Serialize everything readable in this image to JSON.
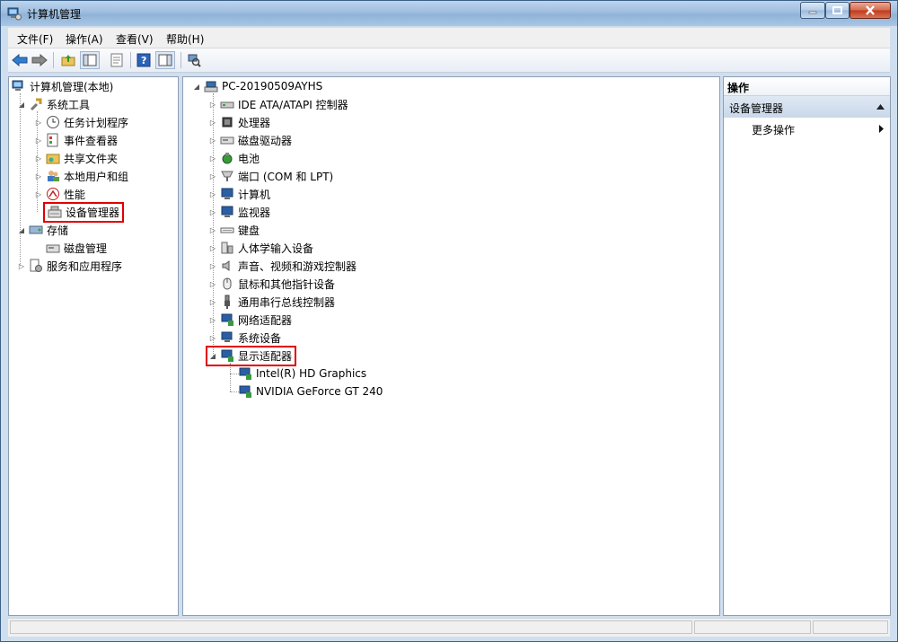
{
  "window": {
    "title": "计算机管理"
  },
  "menubar": {
    "items": [
      "文件(F)",
      "操作(A)",
      "查看(V)",
      "帮助(H)"
    ]
  },
  "left_tree": {
    "root": "计算机管理(本地)",
    "system_tools": "系统工具",
    "system_children": [
      "任务计划程序",
      "事件查看器",
      "共享文件夹",
      "本地用户和组",
      "性能",
      "设备管理器"
    ],
    "storage": "存储",
    "storage_children": [
      "磁盘管理"
    ],
    "services": "服务和应用程序"
  },
  "device_tree": {
    "root": "PC-20190509AYHS",
    "categories": [
      "IDE ATA/ATAPI 控制器",
      "处理器",
      "磁盘驱动器",
      "电池",
      "端口 (COM 和 LPT)",
      "计算机",
      "监视器",
      "键盘",
      "人体学输入设备",
      "声音、视频和游戏控制器",
      "鼠标和其他指针设备",
      "通用串行总线控制器",
      "网络适配器",
      "系统设备",
      "显示适配器"
    ],
    "display_adapters": [
      "Intel(R) HD Graphics",
      "NVIDIA GeForce GT 240"
    ]
  },
  "actions": {
    "header": "操作",
    "section": "设备管理器",
    "more": "更多操作"
  },
  "colors": {
    "highlight": "#e00000",
    "accent": "#3c7fb1"
  }
}
